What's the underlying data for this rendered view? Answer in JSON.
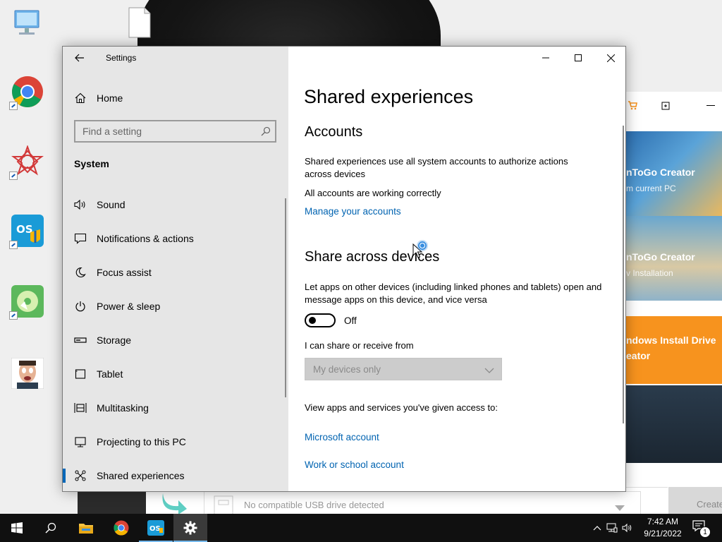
{
  "settings_window": {
    "title": "Settings",
    "nav": {
      "home_label": "Home",
      "search_placeholder": "Find a setting",
      "section_title": "System",
      "items": [
        {
          "label": "Sound",
          "icon": "speaker-icon"
        },
        {
          "label": "Notifications & actions",
          "icon": "notification-icon"
        },
        {
          "label": "Focus assist",
          "icon": "moon-icon"
        },
        {
          "label": "Power & sleep",
          "icon": "power-icon"
        },
        {
          "label": "Storage",
          "icon": "storage-icon"
        },
        {
          "label": "Tablet",
          "icon": "tablet-icon"
        },
        {
          "label": "Multitasking",
          "icon": "multitasking-icon"
        },
        {
          "label": "Projecting to this PC",
          "icon": "projector-icon"
        },
        {
          "label": "Shared experiences",
          "icon": "shared-experiences-icon",
          "selected": true
        }
      ]
    },
    "content": {
      "page_title": "Shared experiences",
      "accounts": {
        "heading": "Accounts",
        "description": "Shared experiences use all system accounts to authorize actions across devices",
        "status": "All accounts are working correctly",
        "manage_link": "Manage your accounts"
      },
      "share_across_devices": {
        "heading": "Share across devices",
        "description": "Let apps on other devices (including linked phones and tablets) open and message apps on this device, and vice versa",
        "toggle_state": "Off",
        "share_from_label": "I can share or receive from",
        "share_from_value": "My devices only"
      },
      "access": {
        "label": "View apps and services you've given access to:",
        "microsoft_account_link": "Microsoft account",
        "work_school_link": "Work or school account"
      }
    }
  },
  "background_app": {
    "tiles": [
      {
        "line1": "nToGo Creator",
        "line2": "m current PC"
      },
      {
        "line1": "nToGo Creator",
        "line2": "v Installation"
      },
      {
        "line1": "ndows Install Drive",
        "line2": "eator"
      }
    ],
    "usb_status": "No compatible USB drive detected",
    "create_button": "Create"
  },
  "taskbar": {
    "time": "7:42 AM",
    "date": "9/21/2022",
    "notification_count": "1"
  },
  "colors": {
    "accent": "#0067b8",
    "link": "#0063b1",
    "nav_background": "#e6e6e6",
    "taskbar": "#101010",
    "orange_tile": "#f7931e"
  }
}
